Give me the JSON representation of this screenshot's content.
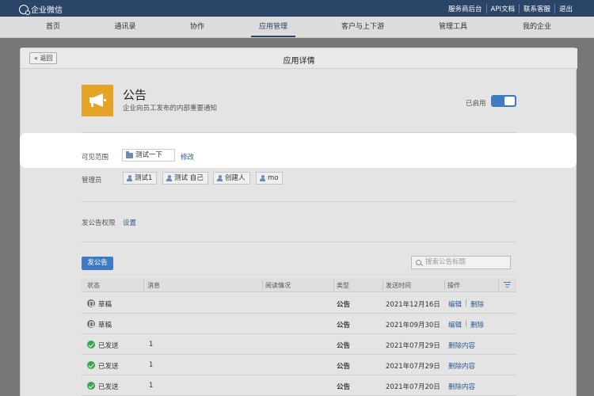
{
  "topbar": {
    "logo_text": "企业微信",
    "links": [
      "服务商后台",
      "API文档",
      "联系客服",
      "退出"
    ]
  },
  "nav": {
    "items": [
      "首页",
      "通讯录",
      "协作",
      "应用管理",
      "客户与上下游",
      "管理工具",
      "我的企业"
    ],
    "active": "应用管理"
  },
  "panel": {
    "back_label": "« 返回",
    "title": "应用详情"
  },
  "app": {
    "icon": "megaphone-icon",
    "icon_color": "#e4a526",
    "name": "公告",
    "description": "企业向员工发布的内部重要通知",
    "enabled_label": "已启用",
    "enabled": true
  },
  "scope": {
    "label": "可见范围",
    "value": "测试一下",
    "edit_label": "修改"
  },
  "admins": {
    "label": "管理员",
    "items": [
      "测试1",
      "测试 自己",
      "创建人",
      "mo"
    ]
  },
  "permission": {
    "label": "发公告权限",
    "set_label": "设置"
  },
  "toolbar": {
    "publish_label": "发公告",
    "search_placeholder": "搜索公告标题"
  },
  "table": {
    "headers": [
      "状态",
      "消息",
      "阅读情况",
      "类型",
      "发送时间",
      "操作"
    ],
    "rows": [
      {
        "status": "草稿",
        "status_kind": "draft",
        "message": "",
        "type": "公告",
        "time": "2021年12月16日",
        "ops": [
          "编辑",
          "删除"
        ]
      },
      {
        "status": "草稿",
        "status_kind": "draft",
        "message": "",
        "type": "公告",
        "time": "2021年09月30日",
        "ops": [
          "编辑",
          "删除"
        ]
      },
      {
        "status": "已发送",
        "status_kind": "sent",
        "message": "1",
        "type": "公告",
        "time": "2021年07月29日",
        "ops": [
          "删除内容"
        ]
      },
      {
        "status": "已发送",
        "status_kind": "sent",
        "message": "1",
        "type": "公告",
        "time": "2021年07月29日",
        "ops": [
          "删除内容"
        ]
      },
      {
        "status": "已发送",
        "status_kind": "sent",
        "message": "1",
        "type": "公告",
        "time": "2021年07月20日",
        "ops": [
          "删除内容"
        ]
      }
    ]
  },
  "colors": {
    "topbar": "#2b4568",
    "primary": "#3f7bc0",
    "link": "#2b5a91",
    "sent": "#3aa54a"
  }
}
